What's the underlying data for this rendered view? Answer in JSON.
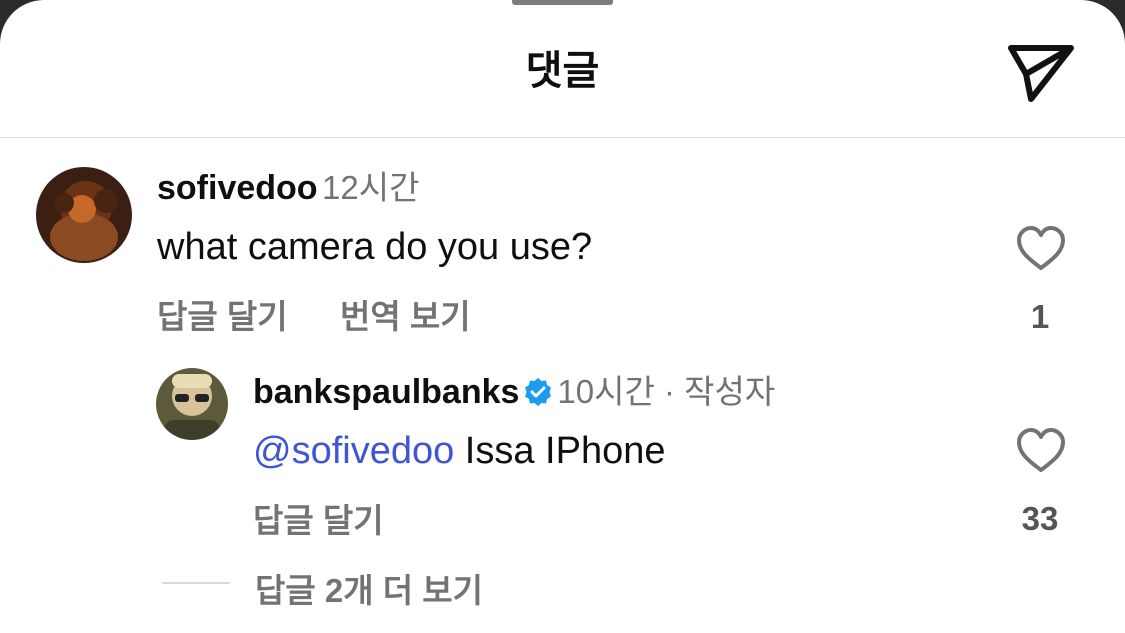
{
  "header": {
    "title": "댓글",
    "share_icon": "send-icon"
  },
  "comments": [
    {
      "username": "sofivedoo",
      "time": "12시간",
      "text": "what camera do you use?",
      "actions": [
        "답글 달기",
        "번역 보기"
      ],
      "likes": "1"
    }
  ],
  "replies": [
    {
      "username": "bankspaulbanks",
      "verified": true,
      "time": "10시간",
      "author_tag": " · 작성자",
      "mention": "@sofivedoo",
      "text": " Issa IPhone",
      "actions": [
        "답글 달기"
      ],
      "likes": "33"
    }
  ],
  "more_replies": "답글 2개 더 보기",
  "colors": {
    "mention": "#3f55d6",
    "verified": "#1d9bf0",
    "muted": "#737373"
  }
}
